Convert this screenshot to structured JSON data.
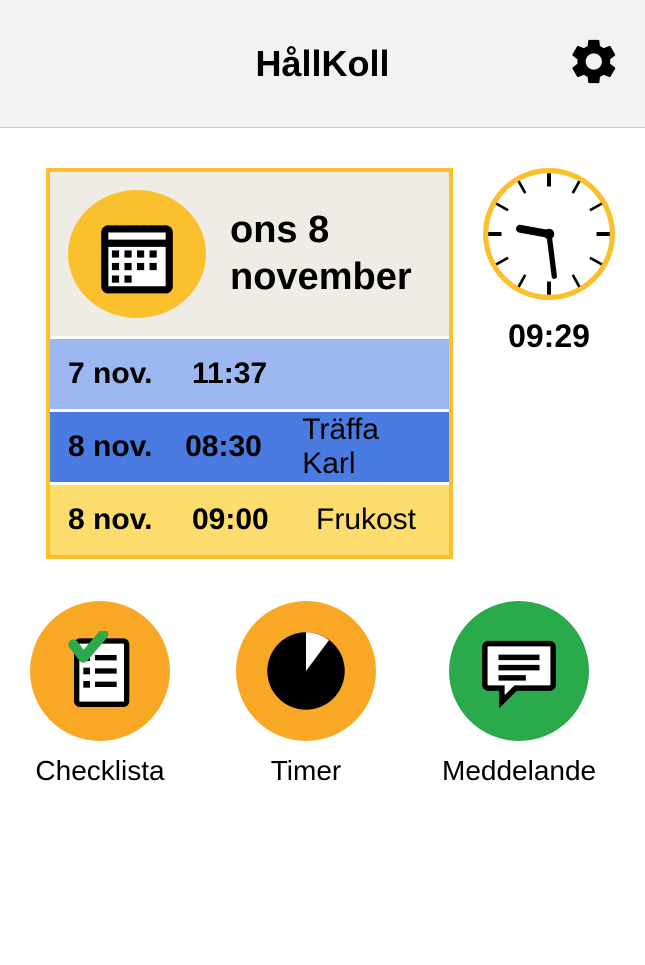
{
  "header": {
    "title": "HållKoll"
  },
  "calendar": {
    "date_line1": "ons 8",
    "date_line2": "november",
    "events": [
      {
        "date": "7 nov.",
        "time": "11:37",
        "title": ""
      },
      {
        "date": "8 nov.",
        "time": "08:30",
        "title": "Träffa Karl"
      },
      {
        "date": "8 nov.",
        "time": "09:00",
        "title": "Frukost"
      }
    ]
  },
  "clock": {
    "time": "09:29"
  },
  "buttons": {
    "checklist": "Checklista",
    "timer": "Timer",
    "message": "Meddelande"
  }
}
